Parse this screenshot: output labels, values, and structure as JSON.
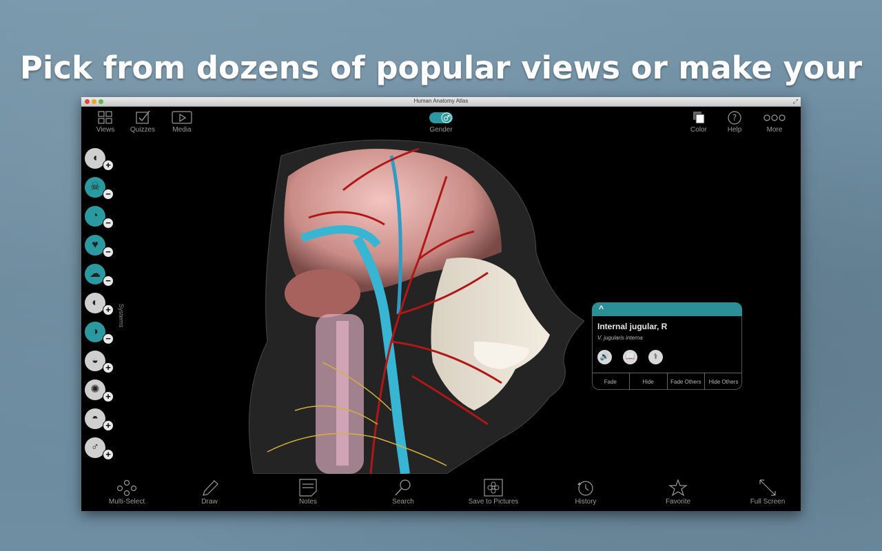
{
  "headline": "Pick from dozens of popular views or make your own.",
  "window": {
    "title": "Human Anatomy Atlas"
  },
  "toolbar": {
    "views": "Views",
    "quizzes": "Quizzes",
    "media": "Media",
    "gender": "Gender",
    "color": "Color",
    "help": "Help",
    "more": "More"
  },
  "sidebar": {
    "label": "Systems",
    "items": [
      {
        "name": "skin-system",
        "sign": "+",
        "active": false
      },
      {
        "name": "skeletal-system",
        "sign": "−",
        "active": true
      },
      {
        "name": "nervous-system",
        "sign": "−",
        "active": true
      },
      {
        "name": "cardiovascular-system",
        "sign": "−",
        "active": true
      },
      {
        "name": "respiratory-system",
        "sign": "−",
        "active": true
      },
      {
        "name": "digestive-system",
        "sign": "+",
        "active": false
      },
      {
        "name": "lymphatic-system",
        "sign": "−",
        "active": true
      },
      {
        "name": "urinary-system",
        "sign": "+",
        "active": false
      },
      {
        "name": "muscular-system",
        "sign": "+",
        "active": false
      },
      {
        "name": "reproductive-system",
        "sign": "+",
        "active": false
      },
      {
        "name": "gender-system",
        "sign": "+",
        "active": false
      }
    ]
  },
  "info_panel": {
    "caret": "^",
    "name": "Internal jugular, R",
    "latin": "V. jugularis interna",
    "actions": [
      "Fade",
      "Hide",
      "Fade Others",
      "Hide Others"
    ]
  },
  "bottom": {
    "multi_select": "Multi-Select",
    "draw": "Draw",
    "notes": "Notes",
    "search": "Search",
    "save": "Save to Pictures",
    "history": "History",
    "favorite": "Favorite",
    "fullscreen": "Full Screen"
  },
  "colors": {
    "accent": "#2a9aa0",
    "background": "#6f8fa3"
  }
}
